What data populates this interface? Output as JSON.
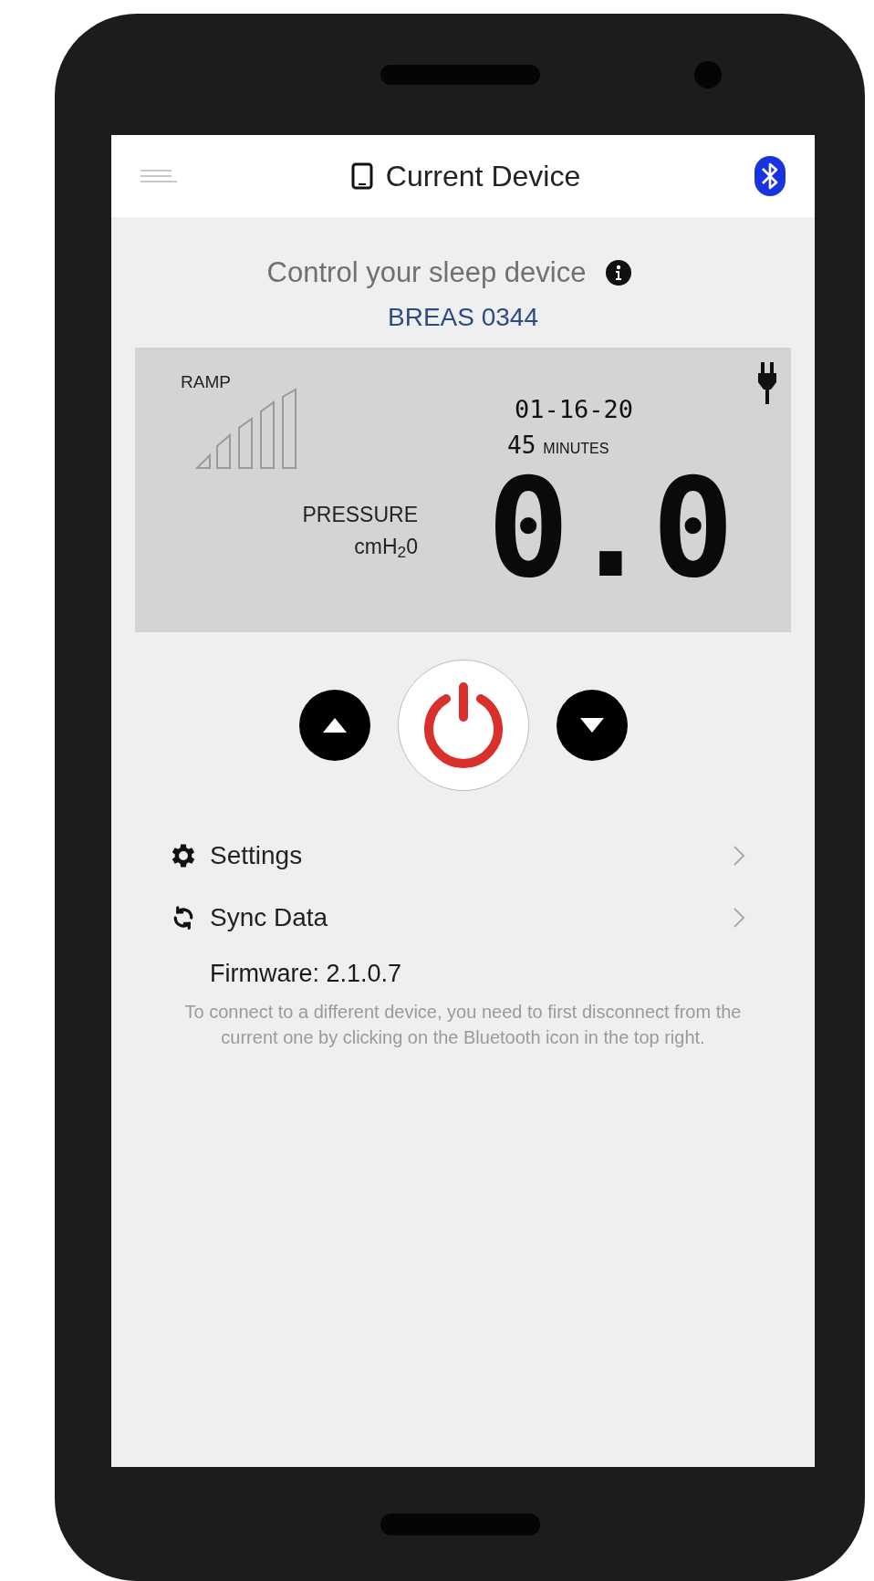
{
  "header": {
    "title": "Current Device"
  },
  "intro": {
    "heading": "Control your sleep device",
    "device_name": "BREAS 0344"
  },
  "display": {
    "ramp_label": "RAMP",
    "date": "01-16-20",
    "duration": "45",
    "duration_unit": "MINUTES",
    "pressure_label": "PRESSURE",
    "pressure_unit": "cmH$_{2}$0",
    "reading": "0.0"
  },
  "menu": [
    {
      "kind": "settings",
      "label": "Settings"
    },
    {
      "kind": "sync",
      "label": "Sync Data"
    }
  ],
  "firmware": "Firmware: 2.1.0.7",
  "note": "To connect to a different device, you need to first disconnect from the current one by clicking on the Bluetooth icon in the top right."
}
